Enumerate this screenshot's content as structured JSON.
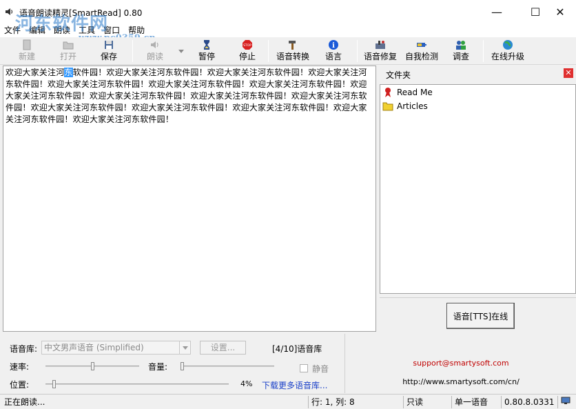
{
  "window": {
    "title": "语音朗读精灵[SmartRead] 0.80",
    "minimize": "—",
    "maximize": "☐",
    "close": "✕"
  },
  "watermark": {
    "big": "河东软件网",
    "small": "www.pc0359.cn"
  },
  "menu": [
    "文件",
    "编辑",
    "朗读",
    "工具",
    "窗口",
    "帮助"
  ],
  "toolbar": {
    "new": "新建",
    "open": "打开",
    "save": "保存",
    "read": "朗读",
    "pause": "暂停",
    "stop": "停止",
    "voice_convert": "语音转换",
    "language": "语言",
    "voice_repair": "语音修复",
    "self_check": "自我检测",
    "survey": "调查",
    "online_upgrade": "在线升级"
  },
  "editor": {
    "text_before": "欢迎大家关注河",
    "text_selected": "东",
    "text_after": "软件园！欢迎大家关注河东软件园！欢迎大家关注河东软件园！欢迎大家关注河东软件园！欢迎大家关注河东软件园！欢迎大家关注河东软件园！欢迎大家关注河东软件园！欢迎大家关注河东软件园！欢迎大家关注河东软件园！欢迎大家关注河东软件园！欢迎大家关注河东软件园！欢迎大家关注河东软件园！欢迎大家关注河东软件园！欢迎大家关注河东软件园！欢迎大家关注河东软件园！欢迎大家关注河东软件园！"
  },
  "side_panel": {
    "header": "文件夹",
    "close": "✕",
    "tree": [
      "Read Me",
      "Articles"
    ],
    "tts_button": "语音[TTS]在线"
  },
  "controls": {
    "voice_lib_label": "语音库:",
    "voice_selected": "中文男声语音 (Simplified)",
    "settings_button": "设置...",
    "voice_count": "[4/10]语音库",
    "rate_label": "速率:",
    "volume_label": "音量:",
    "mute_label": "静音",
    "position_label": "位置:",
    "position_percent": "4%",
    "download_link": "下载更多语音库...",
    "rate_value": 0.5,
    "volume_value": 0.0,
    "position_value": 0.04
  },
  "info": {
    "email": "support@smartysoft.com",
    "url": "http://www.smartysoft.com/cn/"
  },
  "status": {
    "state": "正在朗读...",
    "cursor": "行: 1, 列: 8",
    "mode": "只读",
    "voice_mode": "单一语音",
    "version": "0.80.8.0331"
  }
}
